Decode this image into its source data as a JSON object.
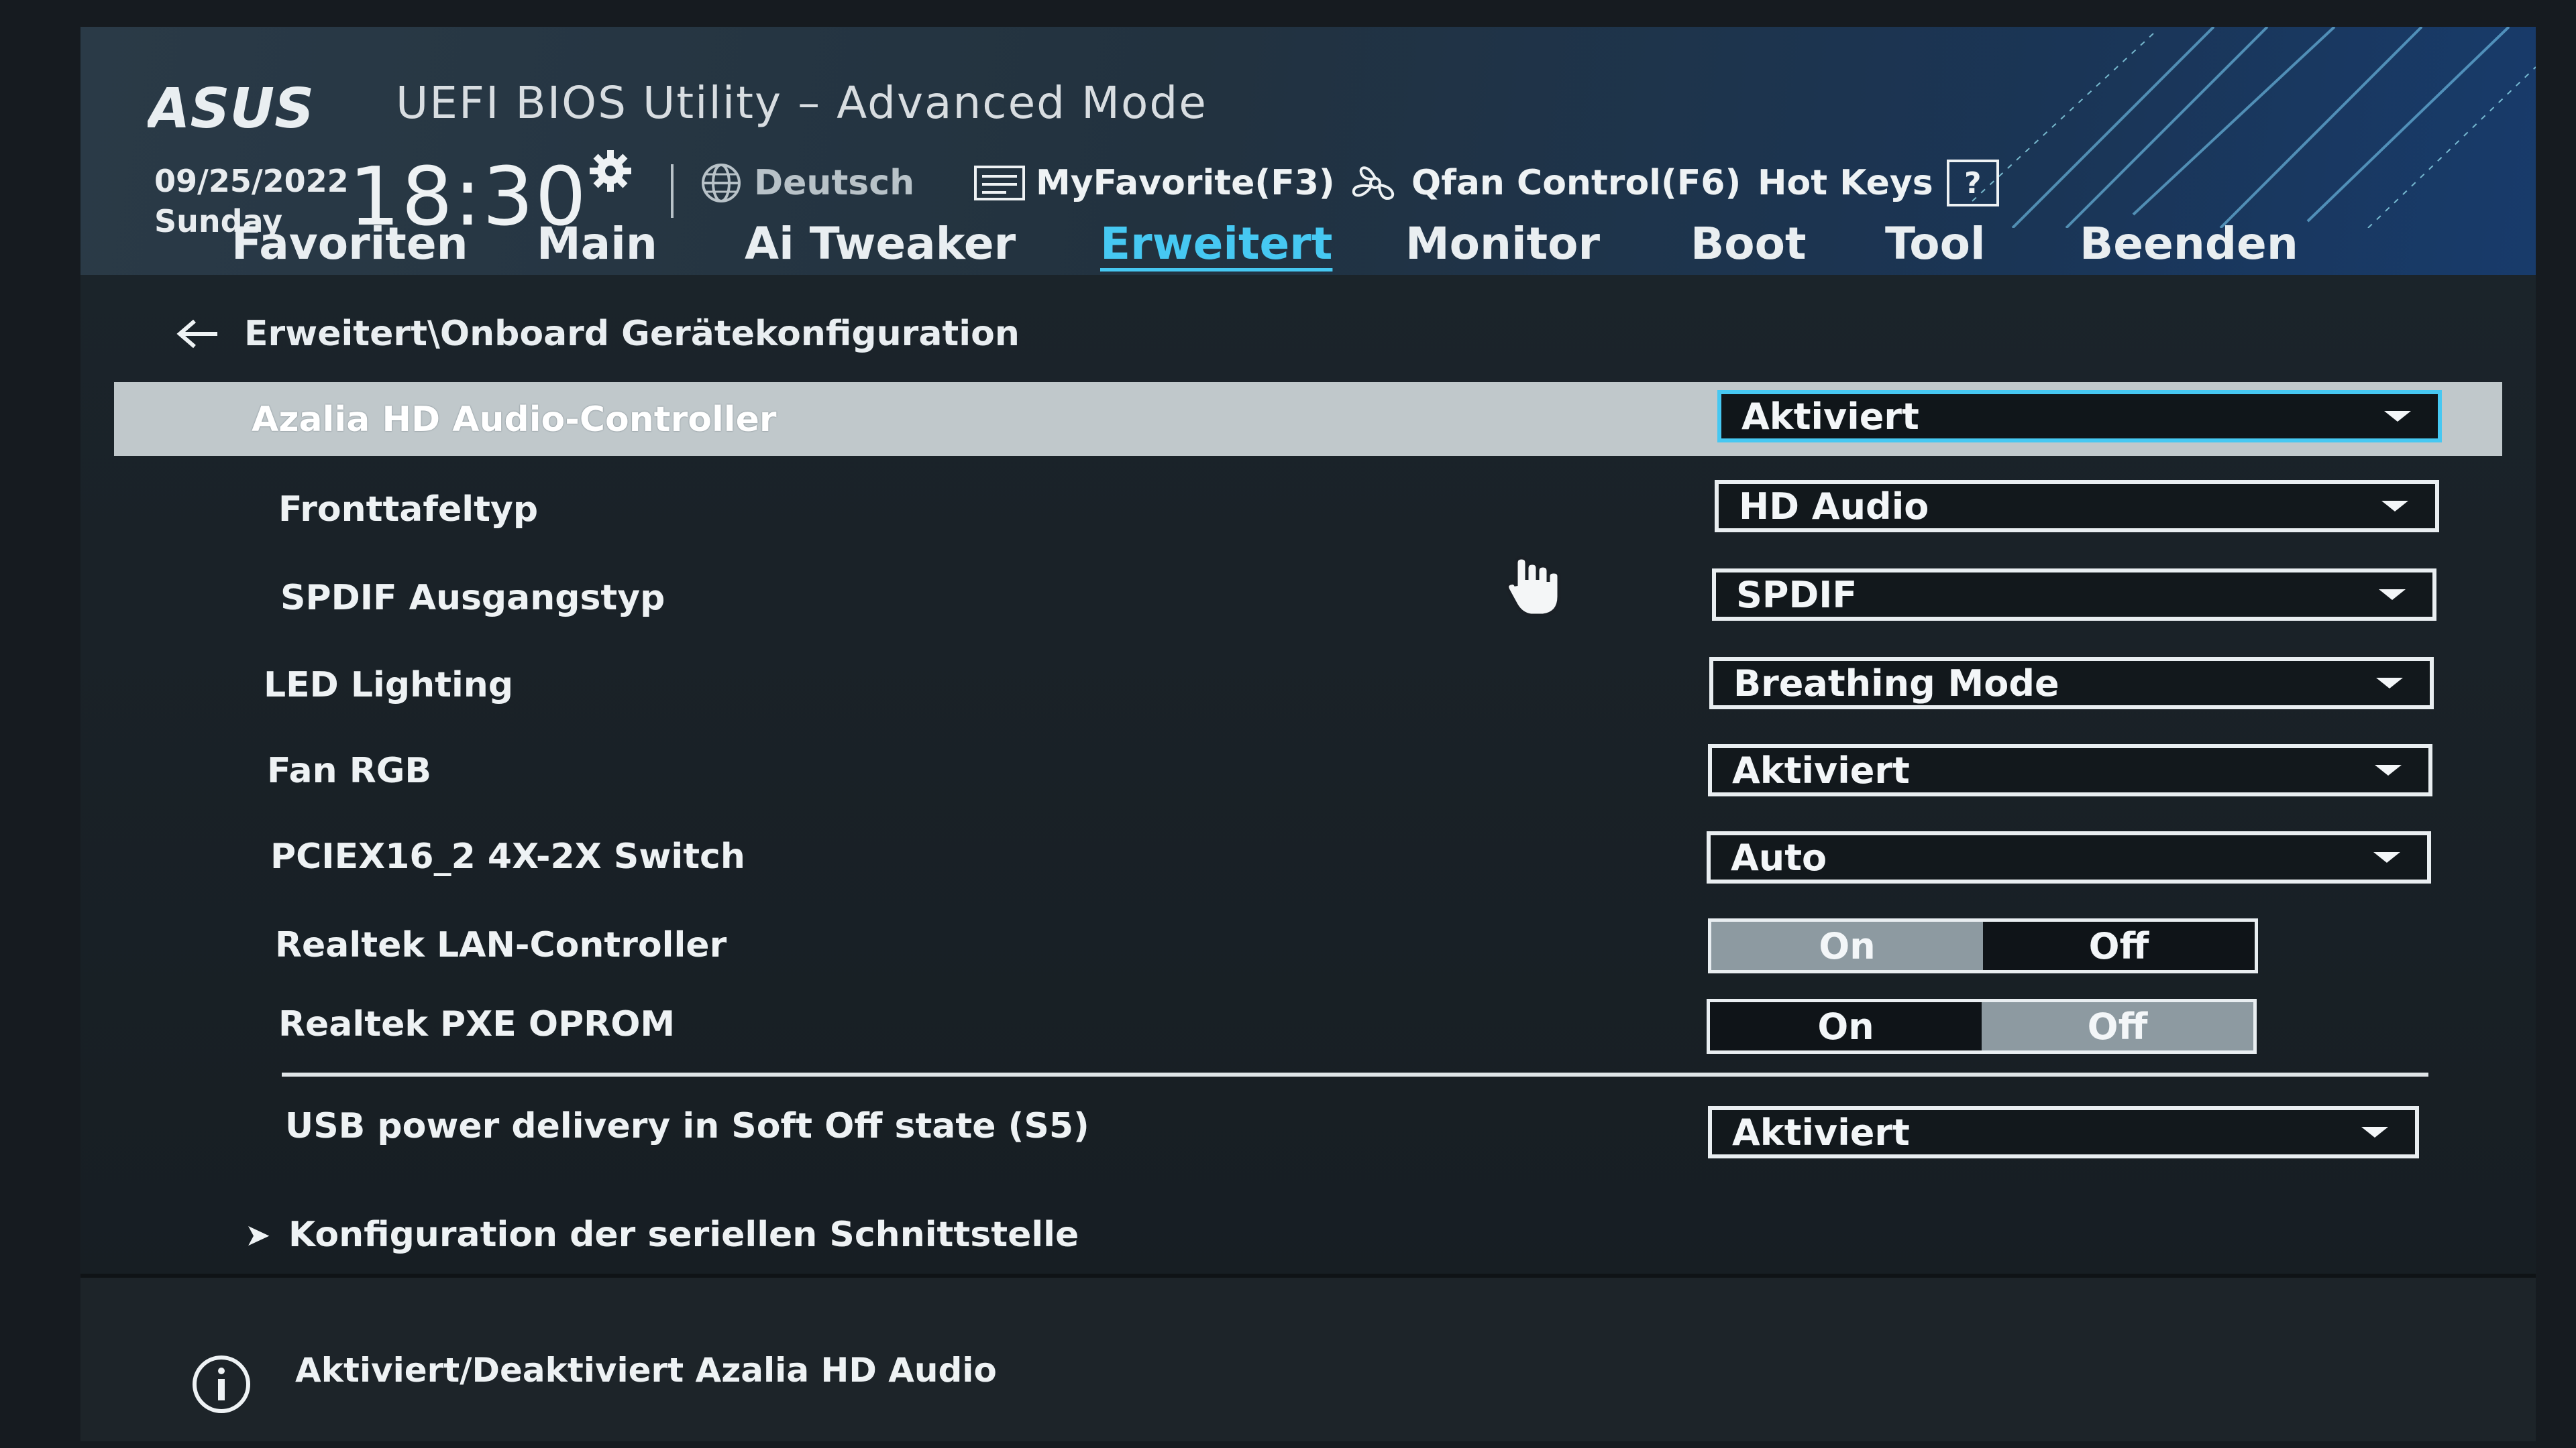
{
  "header": {
    "logo_text": "ASUS",
    "title": "UEFI BIOS Utility – Advanced Mode",
    "date": "09/25/2022",
    "weekday": "Sunday",
    "time": "18:30",
    "language": "Deutsch",
    "myfavorite": "MyFavorite(F3)",
    "qfan": "Qfan Control(F6)",
    "hotkeys": "Hot Keys",
    "hotkeys_key": "?"
  },
  "tabs": [
    {
      "label": "Favoriten"
    },
    {
      "label": "Main"
    },
    {
      "label": "Ai Tweaker"
    },
    {
      "label": "Erweitert",
      "active": true
    },
    {
      "label": "Monitor"
    },
    {
      "label": "Boot"
    },
    {
      "label": "Tool"
    },
    {
      "label": "Beenden"
    }
  ],
  "breadcrumb": "Erweitert\\Onboard Gerätekonfiguration",
  "settings": [
    {
      "label": "Azalia HD Audio-Controller",
      "value": "Aktiviert",
      "type": "dropdown",
      "selected": true
    },
    {
      "label": "Fronttafeltyp",
      "value": "HD Audio",
      "type": "dropdown"
    },
    {
      "label": "SPDIF Ausgangstyp",
      "value": "SPDIF",
      "type": "dropdown"
    },
    {
      "label": "LED Lighting",
      "value": "Breathing Mode",
      "type": "dropdown"
    },
    {
      "label": "Fan RGB",
      "value": "Aktiviert",
      "type": "dropdown"
    },
    {
      "label": "PCIEX16_2 4X-2X Switch",
      "value": "Auto",
      "type": "dropdown"
    },
    {
      "label": "Realtek LAN-Controller",
      "type": "toggle",
      "on_label": "On",
      "off_label": "Off",
      "state": "On"
    },
    {
      "label": "Realtek PXE OPROM",
      "type": "toggle",
      "on_label": "On",
      "off_label": "Off",
      "state": "Off"
    },
    {
      "label": "USB power delivery in Soft Off state (S5)",
      "value": "Aktiviert",
      "type": "dropdown"
    },
    {
      "label": "Konfiguration der seriellen Schnittstelle",
      "type": "submenu"
    }
  ],
  "info": {
    "text": "Aktiviert/Deaktiviert Azalia HD Audio"
  },
  "colors": {
    "accent": "#46c8f2",
    "highlight": "#c0c8cb",
    "background": "#1a2228"
  }
}
